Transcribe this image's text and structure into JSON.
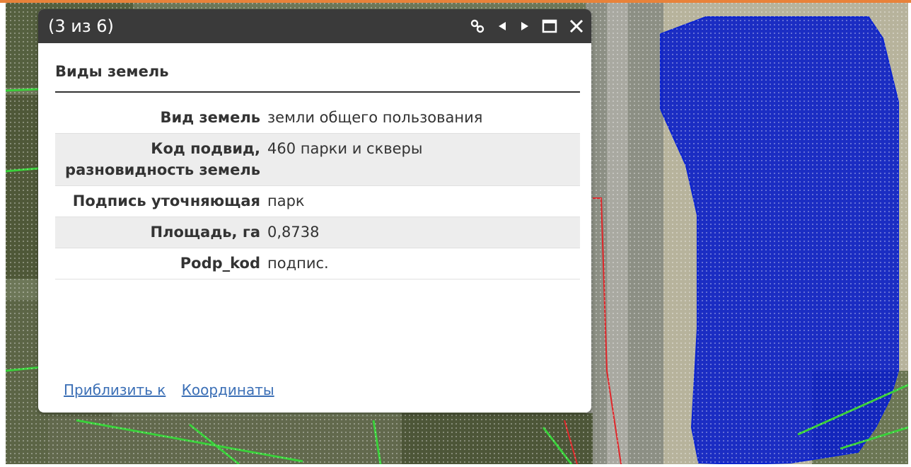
{
  "colors": {
    "accent_top": "#e8823a",
    "popup_header": "#3a3a3a",
    "selection_fill": "#0a1ec8",
    "link": "#3b6fb6",
    "map_line_green": "#39d03a",
    "map_line_red": "#e0262a"
  },
  "popup": {
    "counter": "(3 из 6)",
    "icons": {
      "link": "link-icon",
      "prev": "previous-arrow-icon",
      "next": "next-arrow-icon",
      "maximize": "maximize-icon",
      "close": "close-icon"
    },
    "layer_title": "Виды земель",
    "attributes": [
      {
        "key": "Вид земель",
        "value": "земли общего пользования"
      },
      {
        "key": "Код подвид, разновидность земель",
        "value": "460 парки и скверы"
      },
      {
        "key": "Подпись уточняющая",
        "value": "парк"
      },
      {
        "key": "Площадь, га",
        "value": "0,8738"
      },
      {
        "key": "Podp_kod",
        "value": "подпис."
      }
    ],
    "links": {
      "zoom_to": "Приблизить к",
      "coordinates": "Координаты"
    }
  }
}
